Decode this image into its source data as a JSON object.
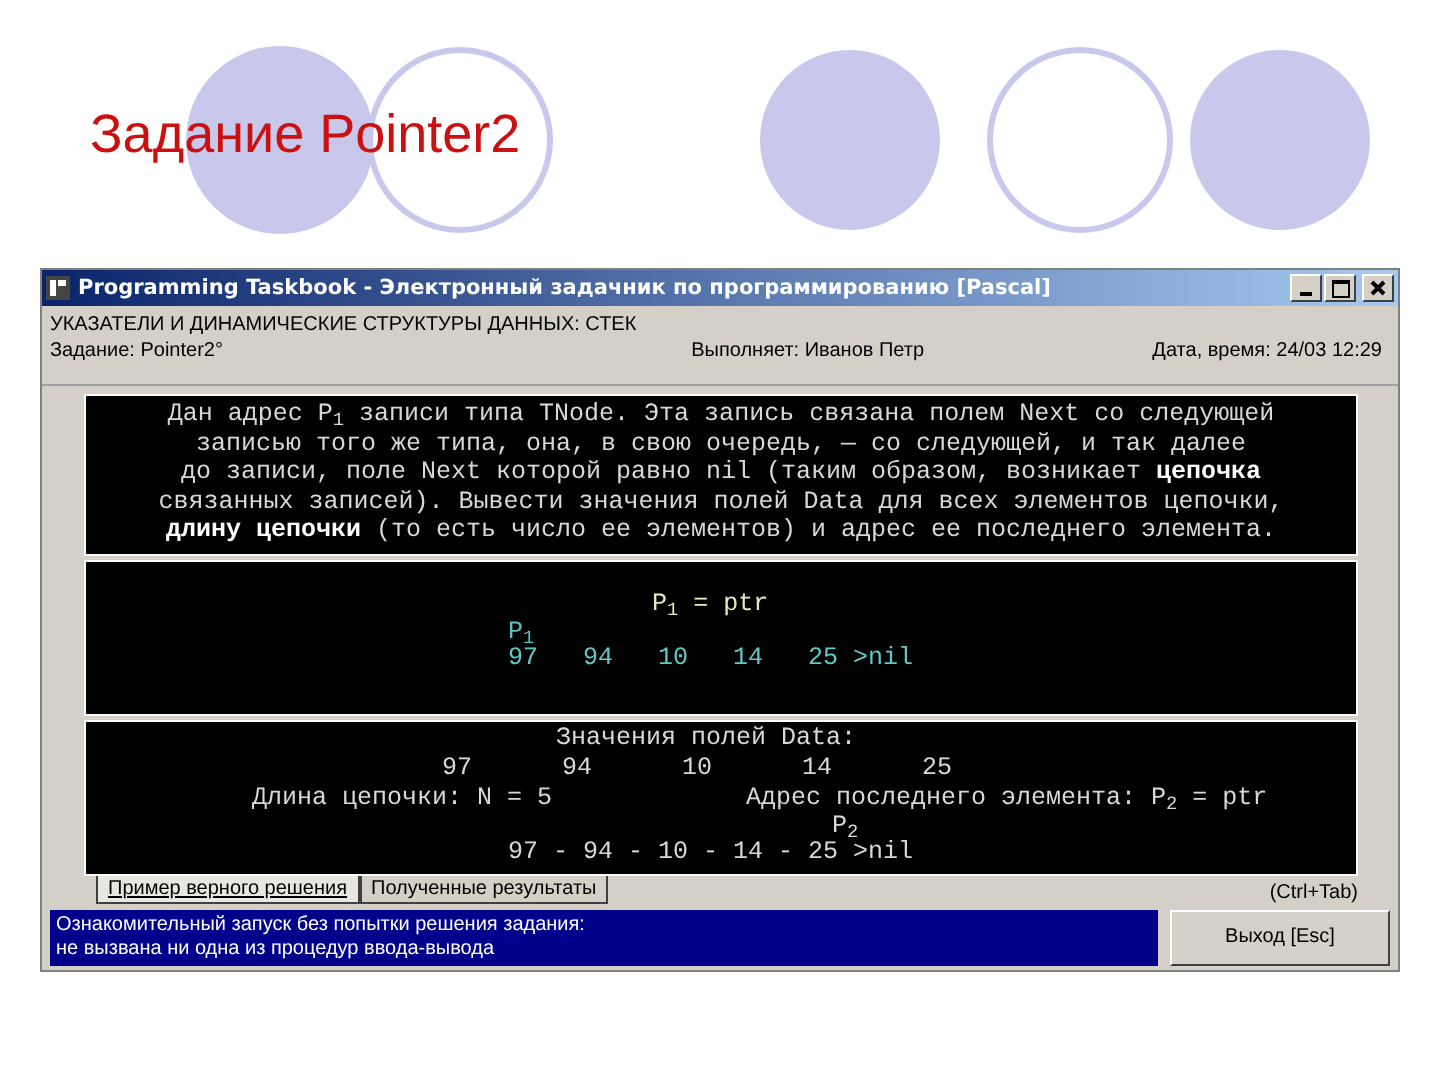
{
  "slide": {
    "title": "Задание Pointer2"
  },
  "window": {
    "title": "Programming Taskbook - Электронный задачник по программированию [Pascal]"
  },
  "header": {
    "topic": "УКАЗАТЕЛИ И ДИНАМИЧЕСКИЕ СТРУКТУРЫ ДАННЫХ: СТЕК",
    "task": "Задание: Pointer2°",
    "performer": "Выполняет: Иванов Петр",
    "datetime": "Дата, время: 24/03 12:29"
  },
  "task_description": {
    "lines": [
      "Дан адрес P$_{1}$ записи типа TNode. Эта запись связана полем Next со следующей",
      "записью того же типа, она, в свою очередь, — со следующей, и так далее",
      "до записи, поле Next которой равно nil (таким образом, возникает **цепочка**",
      "связанных записей). Вывести значения полей Data для всех элементов цепочки,",
      "**длину цепочки** (то есть число ее элементов) и адрес ее последнего элемента."
    ]
  },
  "input_panel": {
    "rows": [
      {
        "kind": "assignment",
        "text": "P$_{1}$ = ptr"
      },
      {
        "kind": "marker",
        "text": "P$_{1}$"
      },
      {
        "kind": "chain",
        "text": "97   94   10   14   25 >nil"
      }
    ]
  },
  "output_panel": {
    "rows": [
      {
        "kind": "heading",
        "text": "Значения полей Data:"
      },
      {
        "kind": "values",
        "text": "97      94      10      14      25"
      },
      {
        "kind": "pair",
        "texts": [
          "Длина цепочки: N = 5",
          "Адрес последнего элемента: P$_{2}$ = ptr"
        ]
      },
      {
        "kind": "marker",
        "text": "P$_{2}$"
      },
      {
        "kind": "chain",
        "text": "97 - 94 - 10 - 14 - 25 >nil"
      }
    ]
  },
  "tabs": [
    {
      "label": "Пример верного решения",
      "selected": true
    },
    {
      "label": "Полученные результаты",
      "selected": false
    }
  ],
  "tab_hint": "(Ctrl+Tab)",
  "status_message": {
    "lines": [
      "Ознакомительный запуск без попытки решения задания:",
      "не вызвана ни одна из процедур ввода-вывода"
    ]
  },
  "exit_button": {
    "label": "Выход [Esc]"
  }
}
